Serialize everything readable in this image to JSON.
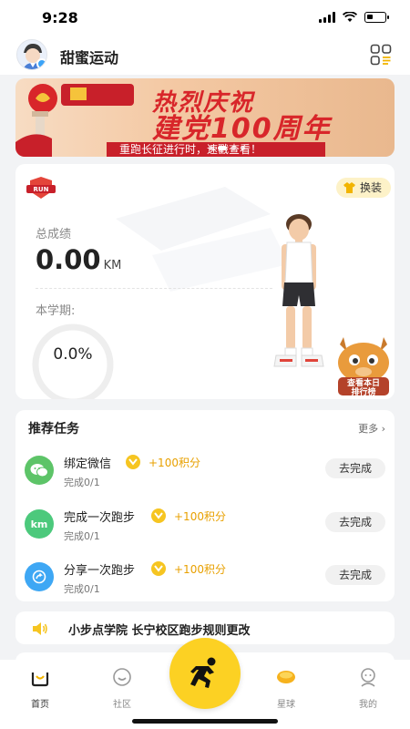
{
  "status": {
    "time": "9:28"
  },
  "header": {
    "app_title": "甜蜜运动"
  },
  "banner": {
    "title_line1": "热烈庆祝",
    "title_line2": "建党100周年",
    "subtitle": "重跑长征进行时，速戳查看！"
  },
  "stats": {
    "swap_label": "换装",
    "total_label": "总成绩",
    "total_value": "0.00",
    "total_unit": "KM",
    "term_label": "本学期:",
    "term_percent": "0.0%",
    "term_progress": 0.0
  },
  "tasks": {
    "title": "推荐任务",
    "more_label": "更多",
    "items": [
      {
        "name": "绑定微信",
        "points": "+100积分",
        "progress": "完成0/1",
        "button": "去完成",
        "icon": "wechat-icon",
        "icon_color": "#5dc468"
      },
      {
        "name": "完成一次跑步",
        "points": "+100积分",
        "progress": "完成0/1",
        "button": "去完成",
        "icon": "km-icon",
        "icon_label": "km",
        "icon_color": "#4cc97c"
      },
      {
        "name": "分享一次跑步",
        "points": "+100积分",
        "progress": "完成0/1",
        "button": "去完成",
        "icon": "share-icon",
        "icon_color": "#3ea7f4"
      }
    ]
  },
  "notice": {
    "text": "小步点学院 长宁校区跑步规则更改"
  },
  "tabbar": {
    "items": [
      {
        "label": "首页",
        "icon": "home-icon",
        "active": true
      },
      {
        "label": "社区",
        "icon": "community-icon",
        "active": false
      },
      {
        "label": "星球",
        "icon": "planet-icon",
        "active": false
      },
      {
        "label": "我的",
        "icon": "profile-icon",
        "active": false
      }
    ]
  },
  "colors": {
    "accent": "#fcd123",
    "points": "#e8a000",
    "banner_red": "#d8262a"
  }
}
